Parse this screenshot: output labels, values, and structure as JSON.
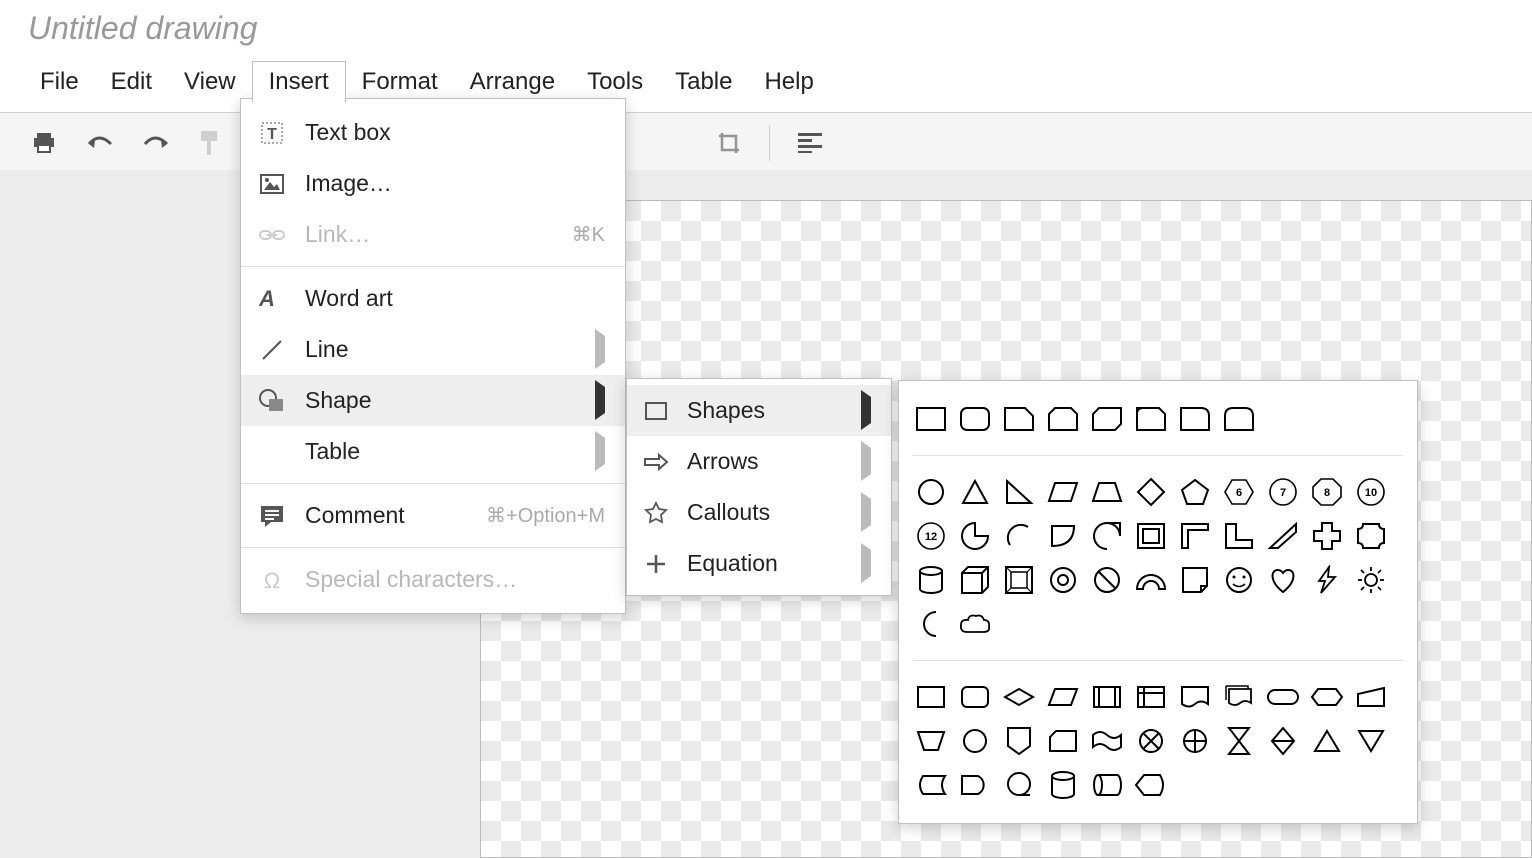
{
  "title": "Untitled drawing",
  "menu": [
    "File",
    "Edit",
    "View",
    "Insert",
    "Format",
    "Arrange",
    "Tools",
    "Table",
    "Help"
  ],
  "menu_active_index": 3,
  "insert_menu": {
    "textbox": "Text box",
    "image": "Image…",
    "link": "Link…",
    "link_shortcut": "⌘K",
    "wordart": "Word art",
    "line": "Line",
    "shape": "Shape",
    "table": "Table",
    "comment": "Comment",
    "comment_shortcut": "⌘+Option+M",
    "special": "Special characters…"
  },
  "shape_submenu": {
    "shapes": "Shapes",
    "arrows": "Arrows",
    "callouts": "Callouts",
    "equation": "Equation"
  },
  "shapes_palette": {
    "group1": [
      "rect",
      "round-rect",
      "snip-1",
      "snip-2",
      "snip-same",
      "round-diag",
      "round-1",
      "round-same"
    ],
    "group2_row1": [
      "circle",
      "triangle",
      "right-triangle",
      "parallelogram",
      "trapezoid",
      "diamond",
      "pentagon",
      "hexagon-6",
      "heptagon-7",
      "octagon-8",
      "decagon-10",
      "dodecagon-12"
    ],
    "group2_row2": [
      "pie",
      "arc",
      "round-pill",
      "teardrop",
      "frame",
      "half-frame",
      "l-shape",
      "diagonal",
      "cross",
      "plaque",
      "can",
      "cube"
    ],
    "group2_row3": [
      "bevel",
      "donut",
      "no-symbol",
      "block-arc",
      "folded-corner",
      "smiley",
      "heart",
      "lightning",
      "sun",
      "moon",
      "cloud"
    ],
    "group3_row1": [
      "flow-process",
      "flow-alt",
      "flow-decision",
      "flow-data",
      "flow-predef",
      "flow-internal",
      "flow-document",
      "flow-multi",
      "flow-terminator",
      "flow-prep",
      "flow-manual-input",
      "flow-manual-op"
    ],
    "group3_row2": [
      "flow-connector",
      "flow-offpage",
      "flow-card",
      "flow-tape",
      "flow-sum",
      "flow-or",
      "flow-collate",
      "flow-sort",
      "flow-extract",
      "flow-merge",
      "flow-stored",
      "flow-delay"
    ],
    "group3_row3": [
      "flow-seq",
      "flow-magnetic",
      "flow-direct",
      "flow-display"
    ]
  }
}
